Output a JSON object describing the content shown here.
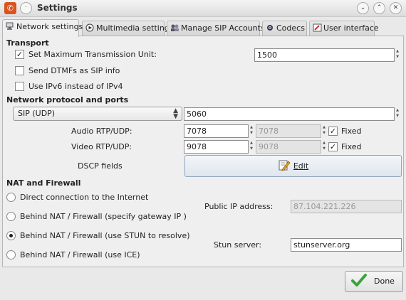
{
  "window": {
    "title": "Settings"
  },
  "tabs": [
    {
      "label": "Network settings",
      "icon": "network-icon"
    },
    {
      "label": "Multimedia settings",
      "icon": "play-icon"
    },
    {
      "label": "Manage SIP Accounts",
      "icon": "accounts-icon"
    },
    {
      "label": "Codecs",
      "icon": "codecs-icon"
    },
    {
      "label": "User interface",
      "icon": "ui-icon"
    }
  ],
  "transport": {
    "heading": "Transport",
    "mtu_label": "Set Maximum Transmission Unit:",
    "mtu_checked": true,
    "mtu_value": "1500",
    "dtmf_label": "Send DTMFs as SIP info",
    "dtmf_checked": false,
    "ipv6_label": "Use IPv6 instead of IPv4",
    "ipv6_checked": false
  },
  "network": {
    "heading": "Network protocol and ports",
    "protocol": "SIP (UDP)",
    "sip_port": "5060",
    "audio_label": "Audio RTP/UDP:",
    "audio_port": "7078",
    "audio_port_disabled": "7078",
    "audio_fixed_label": "Fixed",
    "audio_fixed": true,
    "video_label": "Video RTP/UDP:",
    "video_port": "9078",
    "video_port_disabled": "9078",
    "video_fixed_label": "Fixed",
    "video_fixed": true,
    "dscp_label": "DSCP fields",
    "edit_label": "Edit"
  },
  "nat": {
    "heading": "NAT and Firewall",
    "options": [
      "Direct connection to the Internet",
      "Behind NAT / Firewall (specify gateway IP )",
      "Behind NAT / Firewall (use STUN to resolve)",
      "Behind NAT / Firewall (use ICE)"
    ],
    "selected_index": 2,
    "public_ip_label": "Public IP address:",
    "public_ip_value": "87.104.221.226",
    "stun_label": "Stun server:",
    "stun_value": "stunserver.org"
  },
  "footer": {
    "done_label": "Done"
  },
  "colors": {
    "accent": "#d9541e",
    "check": "#3aa33a"
  }
}
